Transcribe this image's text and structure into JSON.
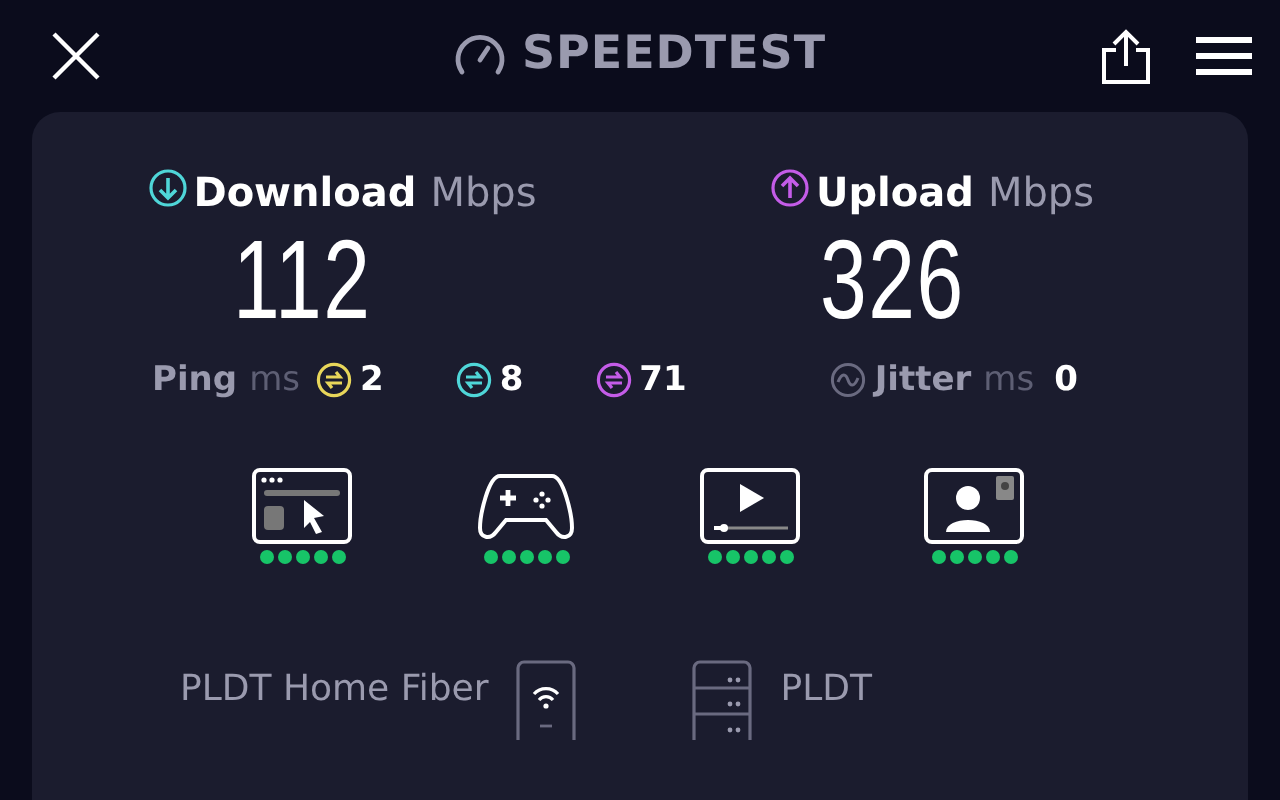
{
  "header": {
    "title": "SPEEDTEST"
  },
  "results": [
    {
      "kind": "download",
      "label": "Download",
      "unit": "Mbps",
      "value": "112"
    },
    {
      "kind": "upload",
      "label": "Upload",
      "unit": "Mbps",
      "value": "326"
    }
  ],
  "ping": {
    "label": "Ping",
    "unit": "ms",
    "values": [
      {
        "kind": "idle",
        "value": "2"
      },
      {
        "kind": "download",
        "value": "8"
      },
      {
        "kind": "upload",
        "value": "71"
      }
    ]
  },
  "jitter": {
    "label": "Jitter",
    "unit": "ms",
    "value": "0"
  },
  "quality": [
    {
      "kind": "browsing",
      "stars": 5
    },
    {
      "kind": "gaming",
      "stars": 5
    },
    {
      "kind": "video",
      "stars": 5
    },
    {
      "kind": "calls",
      "stars": 5
    }
  ],
  "connection": {
    "provider": "PLDT Home Fiber",
    "server": "PLDT"
  }
}
